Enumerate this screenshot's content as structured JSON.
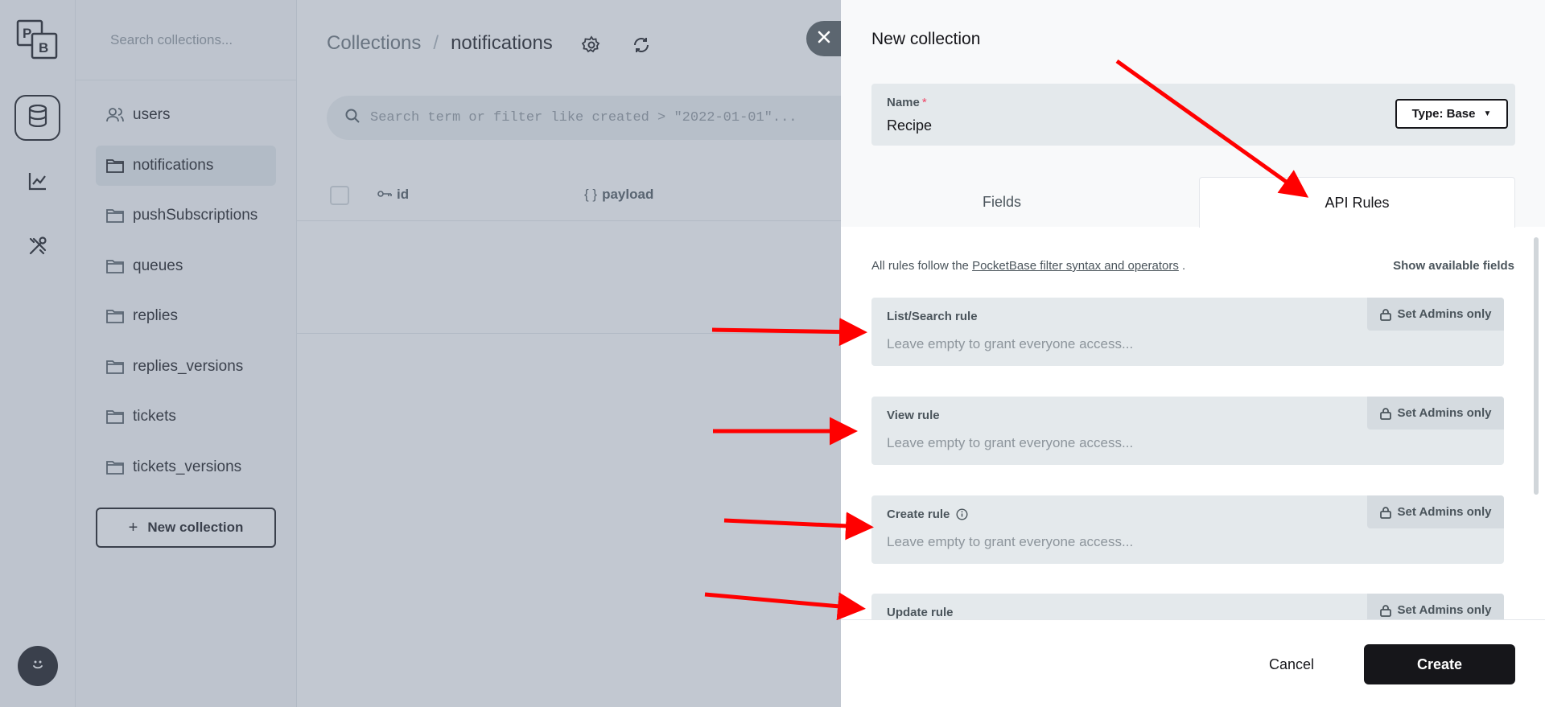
{
  "app": {
    "logo_text": "PB",
    "rail": [
      {
        "icon": "database-icon",
        "active": true
      },
      {
        "icon": "chart-line-icon",
        "active": false
      },
      {
        "icon": "tools-icon",
        "active": false
      }
    ]
  },
  "sidebar": {
    "search_placeholder": "Search collections...",
    "items": [
      {
        "label": "users",
        "icon": "users-icon"
      },
      {
        "label": "notifications",
        "icon": "folder-icon",
        "active": true
      },
      {
        "label": "pushSubscriptions",
        "icon": "folder-icon"
      },
      {
        "label": "queues",
        "icon": "folder-icon"
      },
      {
        "label": "replies",
        "icon": "folder-icon"
      },
      {
        "label": "replies_versions",
        "icon": "folder-icon"
      },
      {
        "label": "tickets",
        "icon": "folder-icon"
      },
      {
        "label": "tickets_versions",
        "icon": "folder-icon"
      }
    ],
    "new_collection_label": "New collection"
  },
  "main": {
    "breadcrumb_root": "Collections",
    "breadcrumb_sep": "/",
    "breadcrumb_current": "notifications",
    "search_placeholder": "Search term or filter like created > \"2022-01-01\"...",
    "columns": [
      {
        "label": "id",
        "icon": "key-icon"
      },
      {
        "label": "payload",
        "icon": "braces-icon"
      }
    ]
  },
  "panel": {
    "title": "New collection",
    "name_label": "Name",
    "name_required_mark": "*",
    "name_value": "Recipe",
    "type_button_label": "Type: Base",
    "tabs": {
      "fields": "Fields",
      "api_rules": "API Rules",
      "active": "api_rules"
    },
    "rules_info_prefix": "All rules follow the ",
    "rules_info_link": "PocketBase filter syntax and operators",
    "rules_info_suffix": " .",
    "show_fields_label": "Show available fields",
    "rules": [
      {
        "label": "List/Search rule",
        "placeholder": "Leave empty to grant everyone access...",
        "admins_label": "Set Admins only"
      },
      {
        "label": "View rule",
        "placeholder": "Leave empty to grant everyone access...",
        "admins_label": "Set Admins only"
      },
      {
        "label": "Create rule",
        "placeholder": "Leave empty to grant everyone access...",
        "admins_label": "Set Admins only",
        "info_icon": true
      },
      {
        "label": "Update rule",
        "placeholder": "",
        "admins_label": "Set Admins only"
      }
    ],
    "cancel_label": "Cancel",
    "create_label": "Create"
  },
  "colors": {
    "accent": "#16161a",
    "annotation_arrow": "#ff0000",
    "required": "#ef4565"
  }
}
